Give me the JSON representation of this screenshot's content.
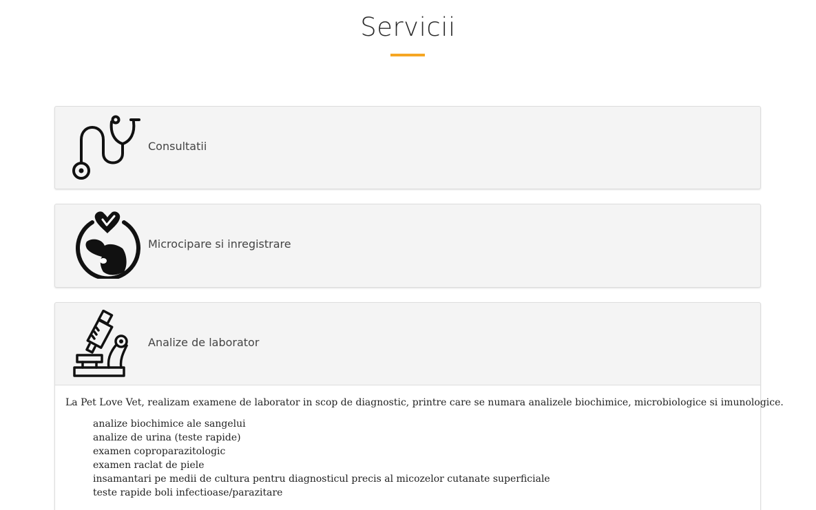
{
  "page": {
    "title": "Servicii",
    "accent_color": "#f5a623"
  },
  "services": [
    {
      "label": "Consultatii",
      "icon": "stethoscope-icon",
      "expanded": false
    },
    {
      "label": "Microcipare si inregistrare",
      "icon": "pet-heart-icon",
      "expanded": false
    },
    {
      "label": "Analize de laborator",
      "icon": "microscope-icon",
      "expanded": true,
      "content": {
        "intro": "La Pet Love Vet, realizam examene de laborator in scop de diagnostic, printre care se numara analizele biochimice, microbiologice si imunologice.",
        "items": [
          "analize biochimice ale sangelui",
          "analize de urina (teste rapide)",
          "examen coproparazitologic",
          "examen raclat de piele",
          "insamantari pe medii de cultura pentru diagnosticul precis al micozelor cutanate superficiale",
          "teste rapide boli infectioase/parazitare"
        ]
      }
    }
  ]
}
